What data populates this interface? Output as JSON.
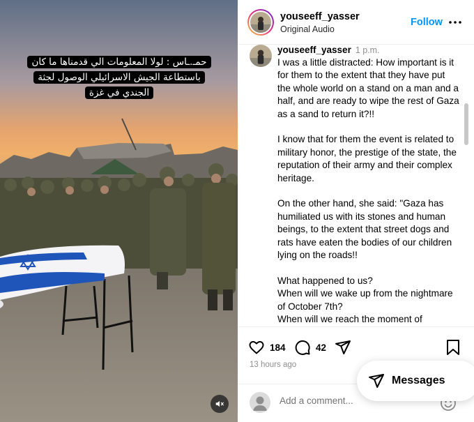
{
  "media": {
    "caption": "حمـ.ـاس : لولا المعلومات الي قدمناها ما كان باستطاعة الجيش الاسرائيلي الوصول لجثة الجندي في غزة",
    "mute_icon": "speaker-muted-icon"
  },
  "header": {
    "username": "youseeff_yasser",
    "subtitle": "Original Audio",
    "follow_label": "Follow",
    "more_icon": "more-options-icon"
  },
  "comment": {
    "username": "youseeff_yasser",
    "time": "1 p.m.",
    "paragraphs": [
      "I was a little distracted: How important is it for them to the extent that they have put the whole world on a stand on a man and a half, and are ready to wipe the rest of Gaza as a sand to return it?!!",
      "I know that for them the event is related to military honor, the prestige of the state, the reputation of their army and their complex heritage.",
      "On the other hand, she said: \"Gaza has humiliated us with its stones and human beings, to the extent that street dogs and rats have eaten the bodies of our children lying on the roads!!",
      "What happened to us?\nWhen will we wake up from the nightmare of October 7th?\nWhen will we reach the moment of realization, that all that happened was"
    ]
  },
  "actions": {
    "likes": "184",
    "comments": "42",
    "posted_ago": "13 hours ago"
  },
  "add_comment": {
    "placeholder": "Add a comment..."
  },
  "messages": {
    "label": "Messages"
  },
  "colors": {
    "accent": "#0095f6",
    "muted_text": "#8e8e8e",
    "border": "#dbdbdb"
  }
}
